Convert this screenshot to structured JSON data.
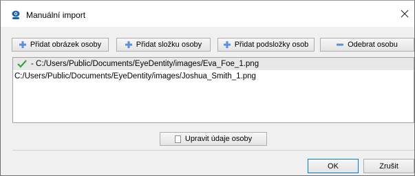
{
  "window": {
    "title": "Manuální import",
    "icon": "eye-app-icon",
    "close_icon": "close-icon"
  },
  "toolbar": {
    "add_person_image": "Přidat obrázek osoby",
    "add_person_folder": "Přidat složku osoby",
    "add_person_subfolders": "Přidat podsložky osob",
    "remove_person": "Odebrat osobu"
  },
  "file_list": {
    "items": [
      {
        "status": "check-icon",
        "text": " - C:/Users/Public/Documents/EyeDentity/images/Eva_Foe_1.png",
        "selected": true
      },
      {
        "status": "",
        "text": "C:/Users/Public/Documents/EyeDentity/images/Joshua_Smith_1.png",
        "selected": false
      }
    ]
  },
  "edit_person_button": "Upravit údaje osoby",
  "dialog_buttons": {
    "ok": "OK",
    "cancel": "Zrušit"
  },
  "colors": {
    "accent": "#0078d7",
    "check": "#3aa142",
    "plus": "#5b8fd6"
  }
}
